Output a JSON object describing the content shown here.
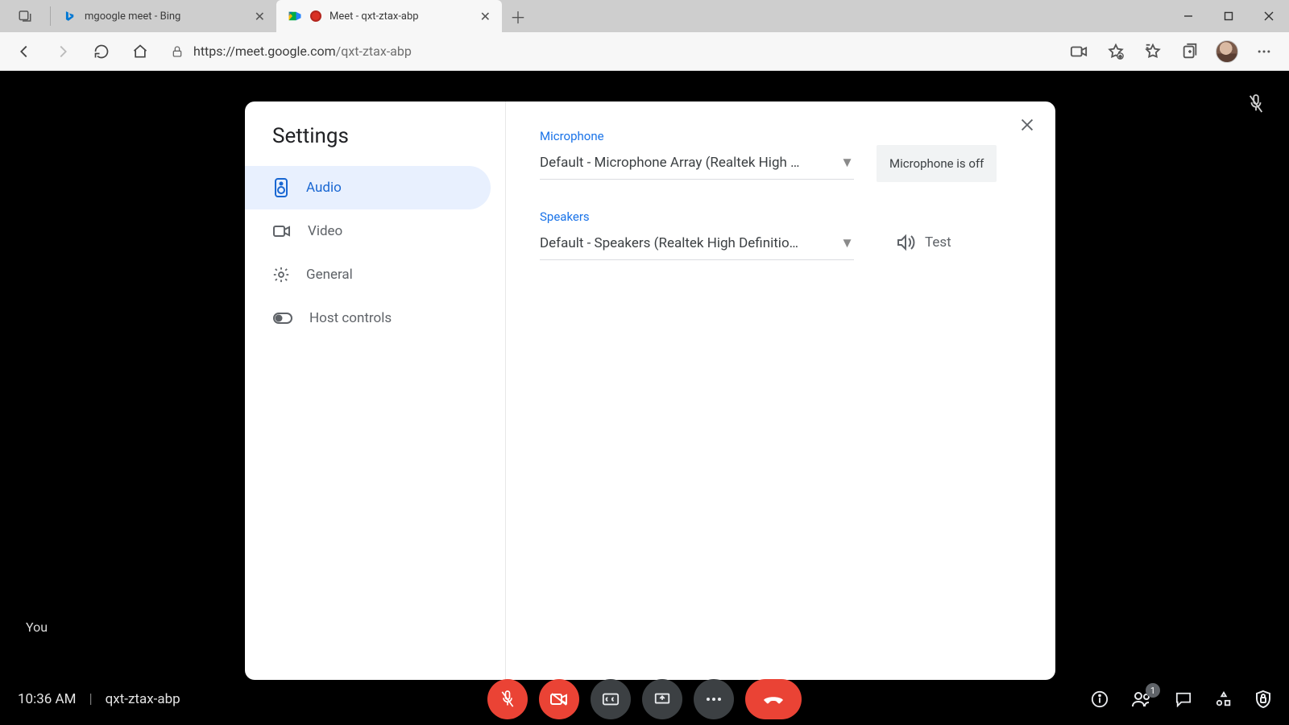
{
  "browser": {
    "tabs": [
      {
        "title": "mgoogle meet - Bing",
        "active": false
      },
      {
        "title": "Meet - qxt-ztax-abp",
        "active": true
      }
    ],
    "url_host": "https://meet.google.com",
    "url_path": "/qxt-ztax-abp"
  },
  "meet": {
    "self_label": "You",
    "time": "10:36 AM",
    "code": "qxt-ztax-abp",
    "participants_badge": "1"
  },
  "settings": {
    "title": "Settings",
    "sidebar": [
      {
        "label": "Audio",
        "active": true
      },
      {
        "label": "Video",
        "active": false
      },
      {
        "label": "General",
        "active": false
      },
      {
        "label": "Host controls",
        "active": false
      }
    ],
    "audio": {
      "mic_heading": "Microphone",
      "mic_value": "Default - Microphone Array (Realtek High …",
      "mic_status": "Microphone is off",
      "spk_heading": "Speakers",
      "spk_value": "Default - Speakers (Realtek High Definitio…",
      "test_label": "Test"
    }
  }
}
